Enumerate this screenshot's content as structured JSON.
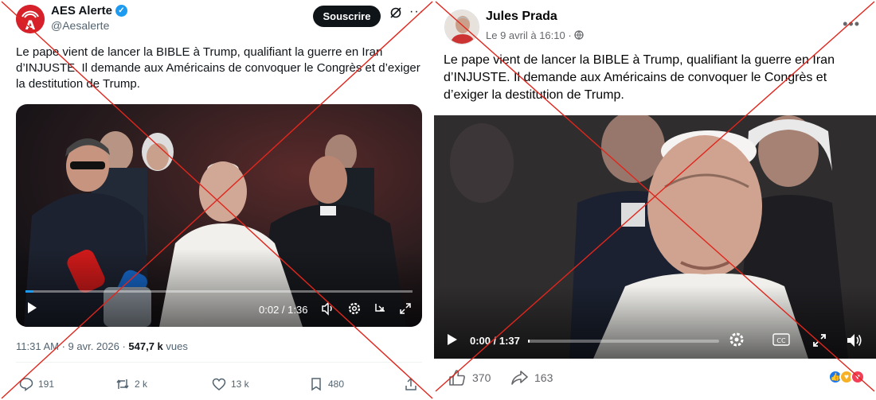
{
  "left_post": {
    "account_name": "AES Alerte",
    "handle": "@Aesalerte",
    "subscribe_label": "Souscrire",
    "text": "Le pape vient de lancer la BIBLE à Trump, qualifiant la guerre en Iran d’INJUSTE. Il demande aux Américains de convoquer le Congrès et d’exiger la destitution de Trump.",
    "video": {
      "time": "0:02 / 1:36",
      "progress": 0.02
    },
    "meta_time": "11:31 AM · 9 avr. 2026 · ",
    "meta_views": "547,7 k",
    "meta_views_label": " vues",
    "actions": {
      "replies": "191",
      "reposts": "2 k",
      "likes": "13 k",
      "bookmarks": "480"
    },
    "icons": [
      "verified-badge-icon",
      "grok-icon",
      "more-icon",
      "play-icon",
      "volume-icon",
      "settings-icon",
      "pip-icon",
      "fullscreen-icon",
      "reply-icon",
      "repost-icon",
      "like-icon",
      "bookmark-icon",
      "share-icon"
    ]
  },
  "right_post": {
    "author": "Jules Prada",
    "date": "Le 9 avril à 16:10 · ",
    "text": "Le pape vient de lancer la BIBLE à Trump, qualifiant la guerre en Iran d’INJUSTE. Il demande aux Américains de convoquer le Congrès et d’exiger la destitution de Trump.",
    "video": {
      "time": "0:00 / 1:37",
      "progress": 0.0
    },
    "likes": "370",
    "shares": "163",
    "icons": [
      "globe-icon",
      "more-icon",
      "play-icon",
      "settings-icon",
      "captions-icon",
      "fullscreen-icon",
      "volume-icon",
      "like-icon",
      "share-icon",
      "like-reaction-icon",
      "care-reaction-icon",
      "love-reaction-icon"
    ]
  },
  "colors": {
    "cross": "#e0261c",
    "x_blue": "#1d9bf0",
    "aes_red": "#d6202a",
    "fb_blue": "#1877f2"
  }
}
